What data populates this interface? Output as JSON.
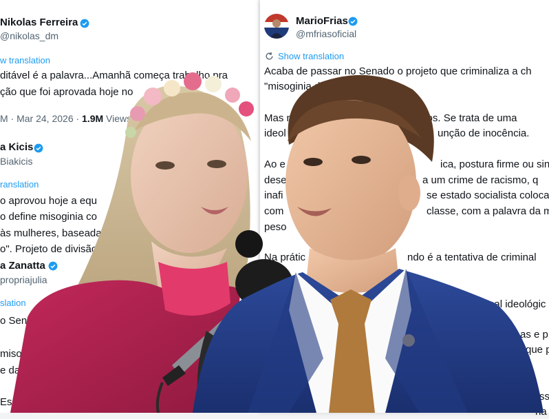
{
  "left_tweets": {
    "t1": {
      "name": "Nikolas Ferreira",
      "handle": "@nikolas_dm",
      "translation": "w translation",
      "line1": "ditável é a palavra...Amanhã começa trabalho pra",
      "line2": "ção que foi aprovada hoje no",
      "meta_prefix": "M · Mar 24, 2026 · ",
      "views_count": "1.9M",
      "views_label": " Views"
    },
    "t2": {
      "name": "a Kicis",
      "handle": "Biakicis",
      "translation": "ranslation",
      "line1": "o aprovou hoje a equ",
      "line2": "o define misoginia co",
      "line3": "às mulheres, baseada",
      "line4": "o\". Projeto de divisão"
    },
    "t3": {
      "name": "a Zanatta",
      "handle": "propriajulia",
      "translation": "slation",
      "line1": "o Sen",
      "line2": "miso",
      "line3": "e das",
      "line4": "Esso"
    }
  },
  "right_tweet": {
    "name": "MarioFrias",
    "handle": "@mfriasoficial",
    "translation": "Show translation",
    "line1": "Acaba de passar no Senado o projeto que criminaliza a ch",
    "line2": "\"misoginia di",
    "line3": "Mas n",
    "line3b": "bonitos. Se trata de uma",
    "line4": "ideol",
    "line4b": "unção de inocência.",
    "line5": "Ao e",
    "line5b": "ica, postura firme ou sin",
    "line6": "dese",
    "line6b": "a um crime de racismo, q",
    "line7": "inafi",
    "line7b": "se estado socialista coloca",
    "line8": "com",
    "line8b": "classe, com a palavra da m",
    "line9": "peso",
    "line10": "Na prátic",
    "line10b": "ndo é a tentativa de criminal",
    "line11": "ibunal ideológic",
    "line12": "as e p",
    "line13": "que p",
    "line14": "Ess",
    "line15": "ha"
  },
  "colors": {
    "accent": "#1d9bf0",
    "verified": "#1d9bf0",
    "muted": "#536471",
    "text": "#0f1419"
  }
}
